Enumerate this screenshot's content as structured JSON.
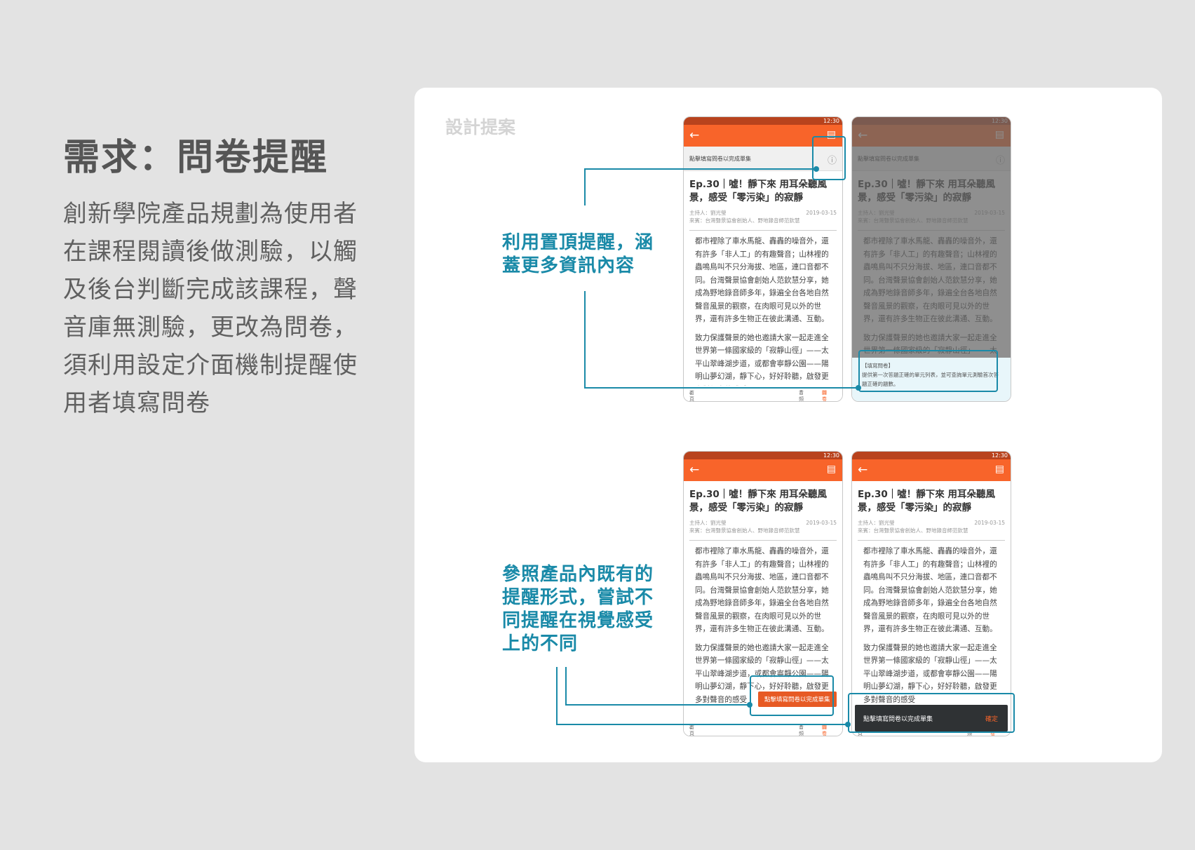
{
  "title": "需求：問卷提醒",
  "description": "創新學院產品規劃為使用者在課程閱讀後做測驗，以觸及後台判斷完成該課程，聲音庫無測驗，更改為問卷，須利用設定介面機制提醒使用者填寫問卷",
  "card_label": "設計提案",
  "note_top": "利用置頂提醒，涵蓋更多資訊內容",
  "note_bottom": "參照產品內既有的提醒形式，嘗試不同提醒在視覺感受上的不同",
  "accent_color": "#1a8aa8",
  "appbar_color": "#f8642a",
  "phone": {
    "status_time": "12:30",
    "back_icon": "←",
    "doc_icon": "▤",
    "banner_text": "點擊填寫問卷以完成單集",
    "info_icon": "ⓘ",
    "episode_title": "Ep.30｜噓！靜下來 用耳朵聽風景，感受「零污染」的寂靜",
    "host": "主持人：劉光瑩",
    "guest": "來賓：台灣聲景協會創始人、野地錄音師范欽慧",
    "date": "2019-03-15",
    "para1": "都市裡除了車水馬龍、轟轟的噪音外，還有許多「非人工」的有趣聲音；山林裡的蟲鳴鳥叫不只分海拔、地區，連口音都不同。台灣聲景協會創始人范欽慧分享，她成為野地錄音師多年，錄遍全台各地自然聲音風景的觀察，在肉眼可見以外的世界，還有許多生物正在彼此溝通、互動。",
    "para2": "致力保護聲景的她也邀請大家一起走進全世界第一條國家級的「寂靜山徑」——太平山翠峰湖步道，或都會寧靜公園——陽明山夢幻湖，靜下心，好好聆聽，啟發更多對聲音的感受",
    "nav_home": "首頁",
    "nav_audio": "音頻",
    "nav_survey": "問卷",
    "info_title": "【填寫問卷】",
    "info_body": "提供第一次答題正確的單元列表，並可查詢單元測驗首次答題正確的題數。",
    "tooltip_text": "點擊填寫問卷以完成單集",
    "snackbar_text": "點擊填寫問卷以完成單集",
    "snackbar_ok": "確定"
  }
}
